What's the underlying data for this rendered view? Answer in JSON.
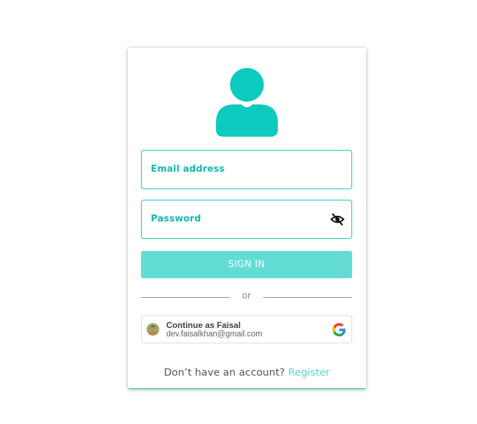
{
  "login": {
    "email_label": "Email address",
    "password_label": "Password",
    "sign_in_label": "SIGN IN",
    "divider_text": "or",
    "google": {
      "title": "Continue as Faisal",
      "email": "dev.faisalkhan@gmail.com"
    },
    "register_prompt": "Don’t have an account?",
    "register_link": "Register"
  },
  "colors": {
    "accent": "#12c7bb",
    "button": "#63ddd4",
    "link": "#5ed6cc"
  },
  "icons": {
    "avatar": "user-silhouette-icon",
    "password_toggle": "eye-off-icon",
    "google": "google-g-icon"
  }
}
